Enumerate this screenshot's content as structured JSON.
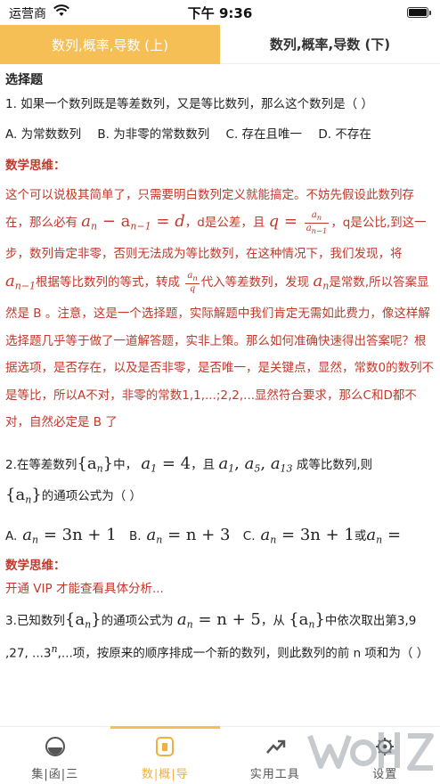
{
  "status": {
    "carrier": "运营商",
    "time": "下午 9:36"
  },
  "tabs": [
    {
      "label": "数列,概率,导数 (上)"
    },
    {
      "label": "数列,概率,导数 (下)"
    }
  ],
  "section": {
    "title": "选择题"
  },
  "q1": {
    "text": "1.  如果一个数列既是等差数列，又是等比数列，那么这个数列是（        ）",
    "options": [
      "A.  为常数数列",
      "B. 为非零的常数数列",
      "C. 存在且唯一",
      "D. 不存在"
    ]
  },
  "analysis1": {
    "title": "数学思维：",
    "p1": "这个可以说极其简单了，只需要明白数列定义就能搞定。不妨先假设此数列存在，那么必有",
    "m1": "a",
    "m1sub": "n",
    "m2": " − a",
    "m2sub": "n−1",
    "m3": " = d",
    "p2": "，d是公差，且",
    "m4": "q = ",
    "fnum": "a",
    "fnumsub": "n",
    "fden": "a",
    "fdensub": "n−1",
    "p3": "，q是公比,到这一步，数列肯定非零，否则无法成为等比数列，在这种情况下，我们发现，将",
    "m5": "a",
    "m5sub": "n−1",
    "p4": "根据等比数列的等式，转成",
    "fnum2": "a",
    "fnum2sub": "n",
    "fden2": "q",
    "p5": "代入等差数列，发现",
    "m6": "a",
    "m6sub": "n",
    "p6": "是常数,所以答案显然是 B 。注意，这是一个选择题，实际解题中我们肯定无需如此费力，像这样解选择题几乎等于做了一道解答题，实非上策。那么如何准确快速得出答案呢？根据选项，是否存在，以及是否非零，是否唯一，是关键点，显然，常数0的数列不是等比，所以A不对，非零的常数1,1,...;2,2,...显然符合要求，那么C和D都不对，自然必定是 B 了"
  },
  "q2": {
    "prefix": "2.在等差数列",
    "seq": "{a",
    "seqsub": "n",
    "seqend": "}",
    "mid": "中，",
    "cond": "a",
    "condsub": "1",
    "condval": " = 4",
    "mid2": "，且",
    "terms": "a",
    "t1": "1",
    "t5": "5",
    "t13": "13",
    "mid3": "成等比数列,则",
    "seq2": "{a",
    "seq2sub": "n",
    "seq2end": "}",
    "suffix": "的通项公式为（        ）",
    "opts": [
      {
        "label": "A.",
        "math": "a",
        "sub": "n",
        "rest": " = 3n + 1"
      },
      {
        "label": "B.",
        "math": "a",
        "sub": "n",
        "rest": " = n + 3"
      },
      {
        "label": "C.",
        "math": "a",
        "sub": "n",
        "rest": " = 3n + 1"
      }
    ],
    "or": "或",
    "tail": "a",
    "tailsub": "n",
    "tailrest": " ="
  },
  "analysis2": {
    "title": "数学思维：",
    "vip": "开通 VIP 才能查看具体分析..."
  },
  "q3": {
    "prefix": "3.已知数列",
    "seq": "{a",
    "seqsub": "n",
    "seqend": "}",
    "mid": "的通项公式为",
    "f": "a",
    "fsub": "n",
    "frest": " = n + 5",
    "mid2": "，从",
    "seq2": "{a",
    "seq2sub": "n",
    "seq2end": "}",
    "mid3": "中依次取出第3,9 ,27, ...3",
    "sup": "n",
    "suffix": ",...项，按原来的顺序排成一个新的数列，则此数列的前 n 项和为（        ）"
  },
  "bottom_nav": [
    {
      "label": "集|函|三",
      "icon": "circle-half-icon"
    },
    {
      "label": "数|概|导",
      "icon": "rounded-square-icon"
    },
    {
      "label": "实用工具",
      "icon": "trend-arrow-icon"
    },
    {
      "label": "设置",
      "icon": "gear-icon"
    }
  ],
  "colors": {
    "accent": "#f6bf55",
    "analysis": "#c0392b",
    "nav_active": "#f0b03b"
  }
}
